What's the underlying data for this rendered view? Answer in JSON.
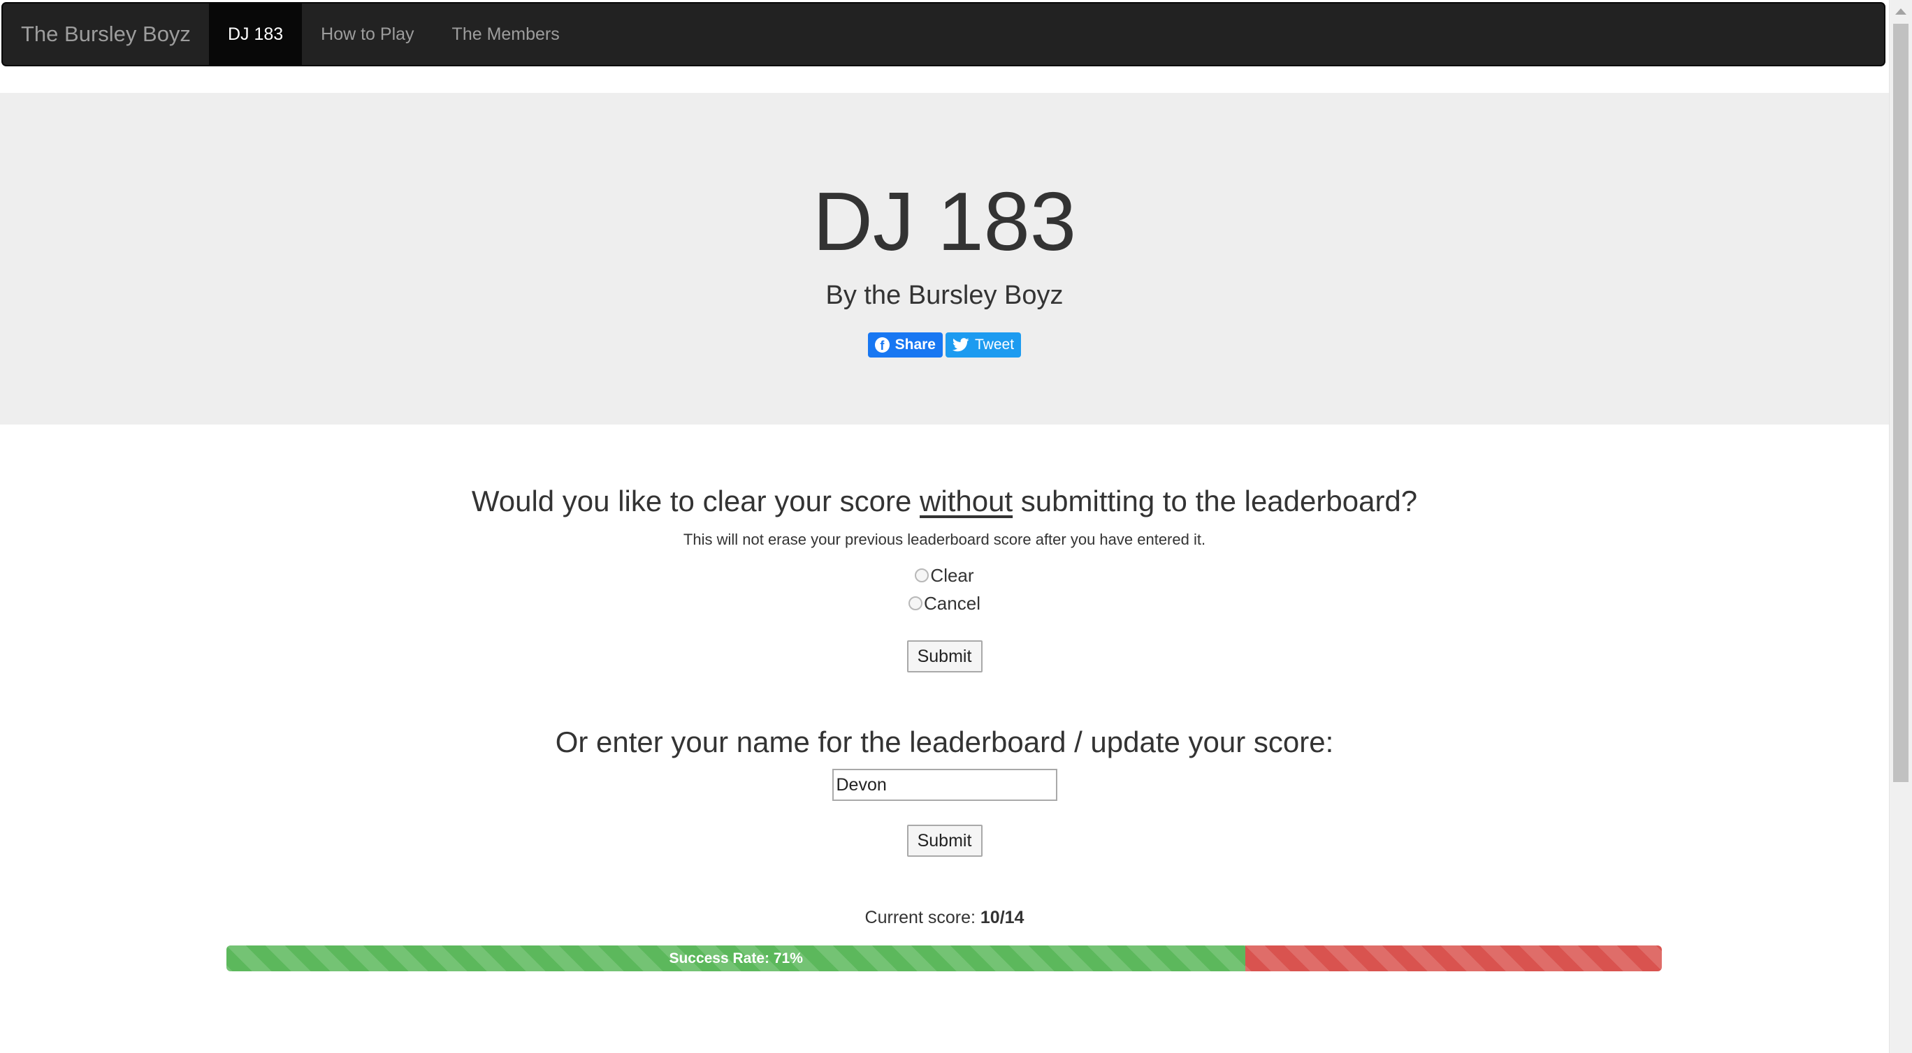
{
  "navbar": {
    "brand": "The Bursley Boyz",
    "items": [
      {
        "label": "DJ 183",
        "active": true
      },
      {
        "label": "How to Play",
        "active": false
      },
      {
        "label": "The Members",
        "active": false
      }
    ]
  },
  "jumbotron": {
    "title": "DJ 183",
    "subtitle": "By the Bursley Boyz",
    "share_label": "Share",
    "tweet_label": "Tweet"
  },
  "clear_form": {
    "question_before": "Would you like to clear your score ",
    "question_emphasis": "without",
    "question_after": " submitting to the leaderboard?",
    "note": "This will not erase your previous leaderboard score after you have entered it.",
    "options": [
      {
        "label": "Clear",
        "checked": false
      },
      {
        "label": "Cancel",
        "checked": false
      }
    ],
    "submit_label": "Submit"
  },
  "leaderboard_form": {
    "heading": "Or enter your name for the leaderboard / update your score:",
    "name_value": "Devon",
    "submit_label": "Submit"
  },
  "score": {
    "label": "Current score: ",
    "value": "10/14",
    "success_fraction": 0.71,
    "success_label": "Success Rate: 71%"
  },
  "colors": {
    "navbar_bg": "#222222",
    "jumbotron_bg": "#eeeeee",
    "facebook": "#1877f2",
    "twitter": "#1d9bf0",
    "progress_success": "#5cb85c",
    "progress_danger": "#d9534f"
  },
  "icons": {
    "facebook": "facebook-icon",
    "twitter": "twitter-icon"
  }
}
